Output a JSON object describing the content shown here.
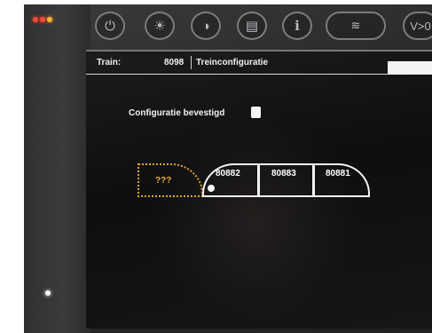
{
  "hardware": {
    "buttons": [
      {
        "icon": "power-icon",
        "glyph": "⏻"
      },
      {
        "icon": "brightness-icon",
        "glyph": "☀"
      },
      {
        "icon": "contrast-icon",
        "glyph": "◑"
      },
      {
        "icon": "screenshot-icon",
        "glyph": "▤"
      },
      {
        "icon": "info-icon",
        "glyph": "ℹ"
      }
    ],
    "wide_icon": "signal-icon",
    "wide_glyph": "≋",
    "edge_label": "V>0"
  },
  "header": {
    "train_label": "Train:",
    "train_number": "8098",
    "title": "Treinconfiguratie"
  },
  "confirm": {
    "label": "Configuratie bevestigd"
  },
  "consist": {
    "unknown_label": "???",
    "cars": [
      "80882",
      "80883",
      "80881"
    ]
  },
  "colors": {
    "unknown_car": "#e2a534",
    "car_outline": "#f2f2f2",
    "led_red": "#ff4a3a",
    "led_amber": "#ffb23a"
  }
}
